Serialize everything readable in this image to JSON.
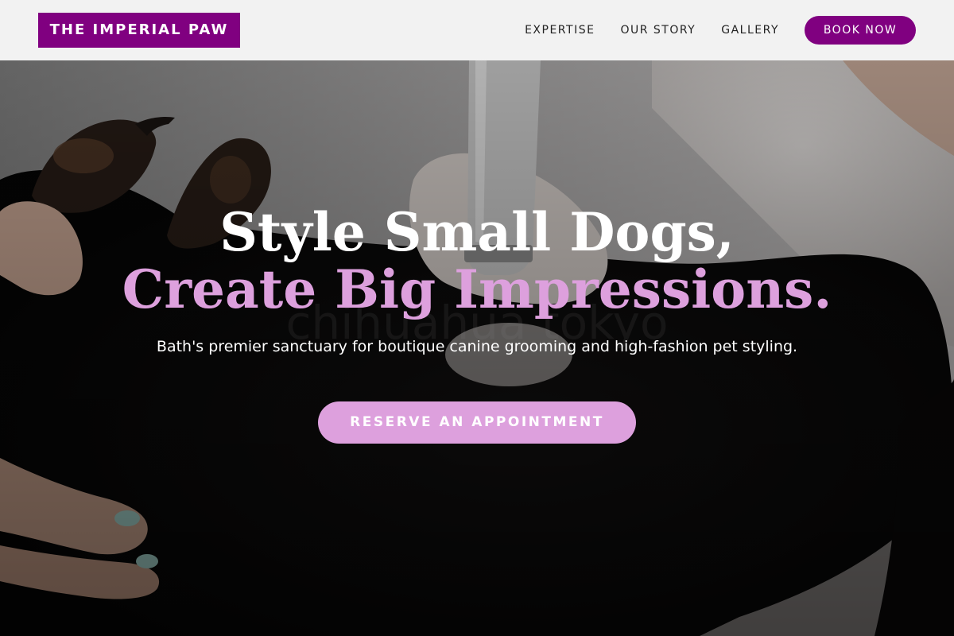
{
  "brand": {
    "name": "THE IMPERIAL PAW",
    "color": "#800080"
  },
  "nav": {
    "items": [
      {
        "label": "EXPERTISE"
      },
      {
        "label": "OUR STORY"
      },
      {
        "label": "GALLERY"
      }
    ],
    "cta_label": "BOOK NOW"
  },
  "hero": {
    "headline_line1": "Style Small Dogs,",
    "headline_line2": "Create Big Impressions.",
    "subtitle": "Bath's premier sanctuary for boutique canine grooming and high-fashion pet styling.",
    "cta_label": "RESERVE AN APPOINTMENT",
    "accent_color": "#dda0dd",
    "background_image": "small-dog-being-groomed-with-clipper"
  }
}
